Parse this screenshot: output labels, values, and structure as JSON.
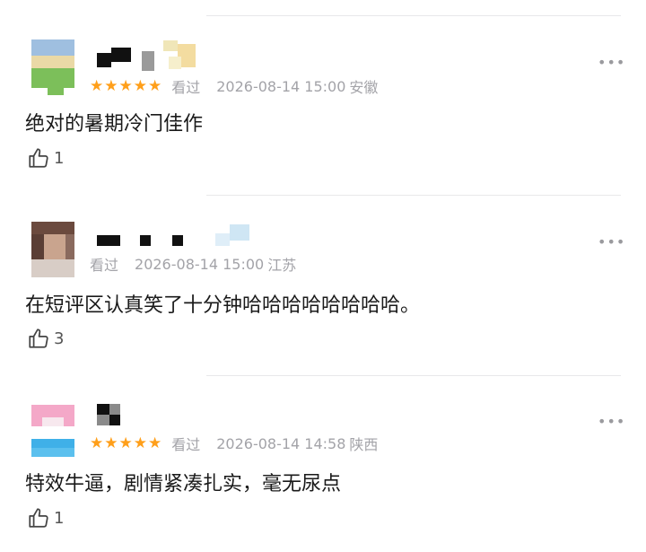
{
  "comments": [
    {
      "stars": "★★★★★",
      "watched": "看过",
      "time": "2026-08-14 15:00",
      "location": "安徽",
      "text": "绝对的暑期冷门佳作",
      "likes": "1",
      "avatar_colors": {
        "top": "#8fb0d6",
        "mid": "#e8d9a8",
        "bottom": "#7cbf5a"
      }
    },
    {
      "stars": "",
      "watched": "看过",
      "time": "2026-08-14 15:00",
      "location": "江苏",
      "text": "在短评区认真笑了十分钟哈哈哈哈哈哈哈哈。",
      "likes": "3",
      "avatar_colors": {
        "top": "#5a3e35",
        "mid": "#c9a48e",
        "bottom": "#d8cdc6"
      }
    },
    {
      "stars": "★★★★★",
      "watched": "看过",
      "time": "2026-08-14 14:58",
      "location": "陕西",
      "text": "特效牛逼，剧情紧凑扎实，毫无尿点",
      "likes": "1",
      "avatar_colors": {
        "top": "#f4a8c8",
        "mid": "#f7e8ee",
        "bottom": "#3fb0e8"
      }
    }
  ],
  "colors": {
    "star": "#ff9f1a",
    "meta": "#a3a3a8",
    "text": "#1a1a1a"
  },
  "icons": {
    "like": "thumbs-up-icon",
    "more": "more-dots-icon"
  }
}
